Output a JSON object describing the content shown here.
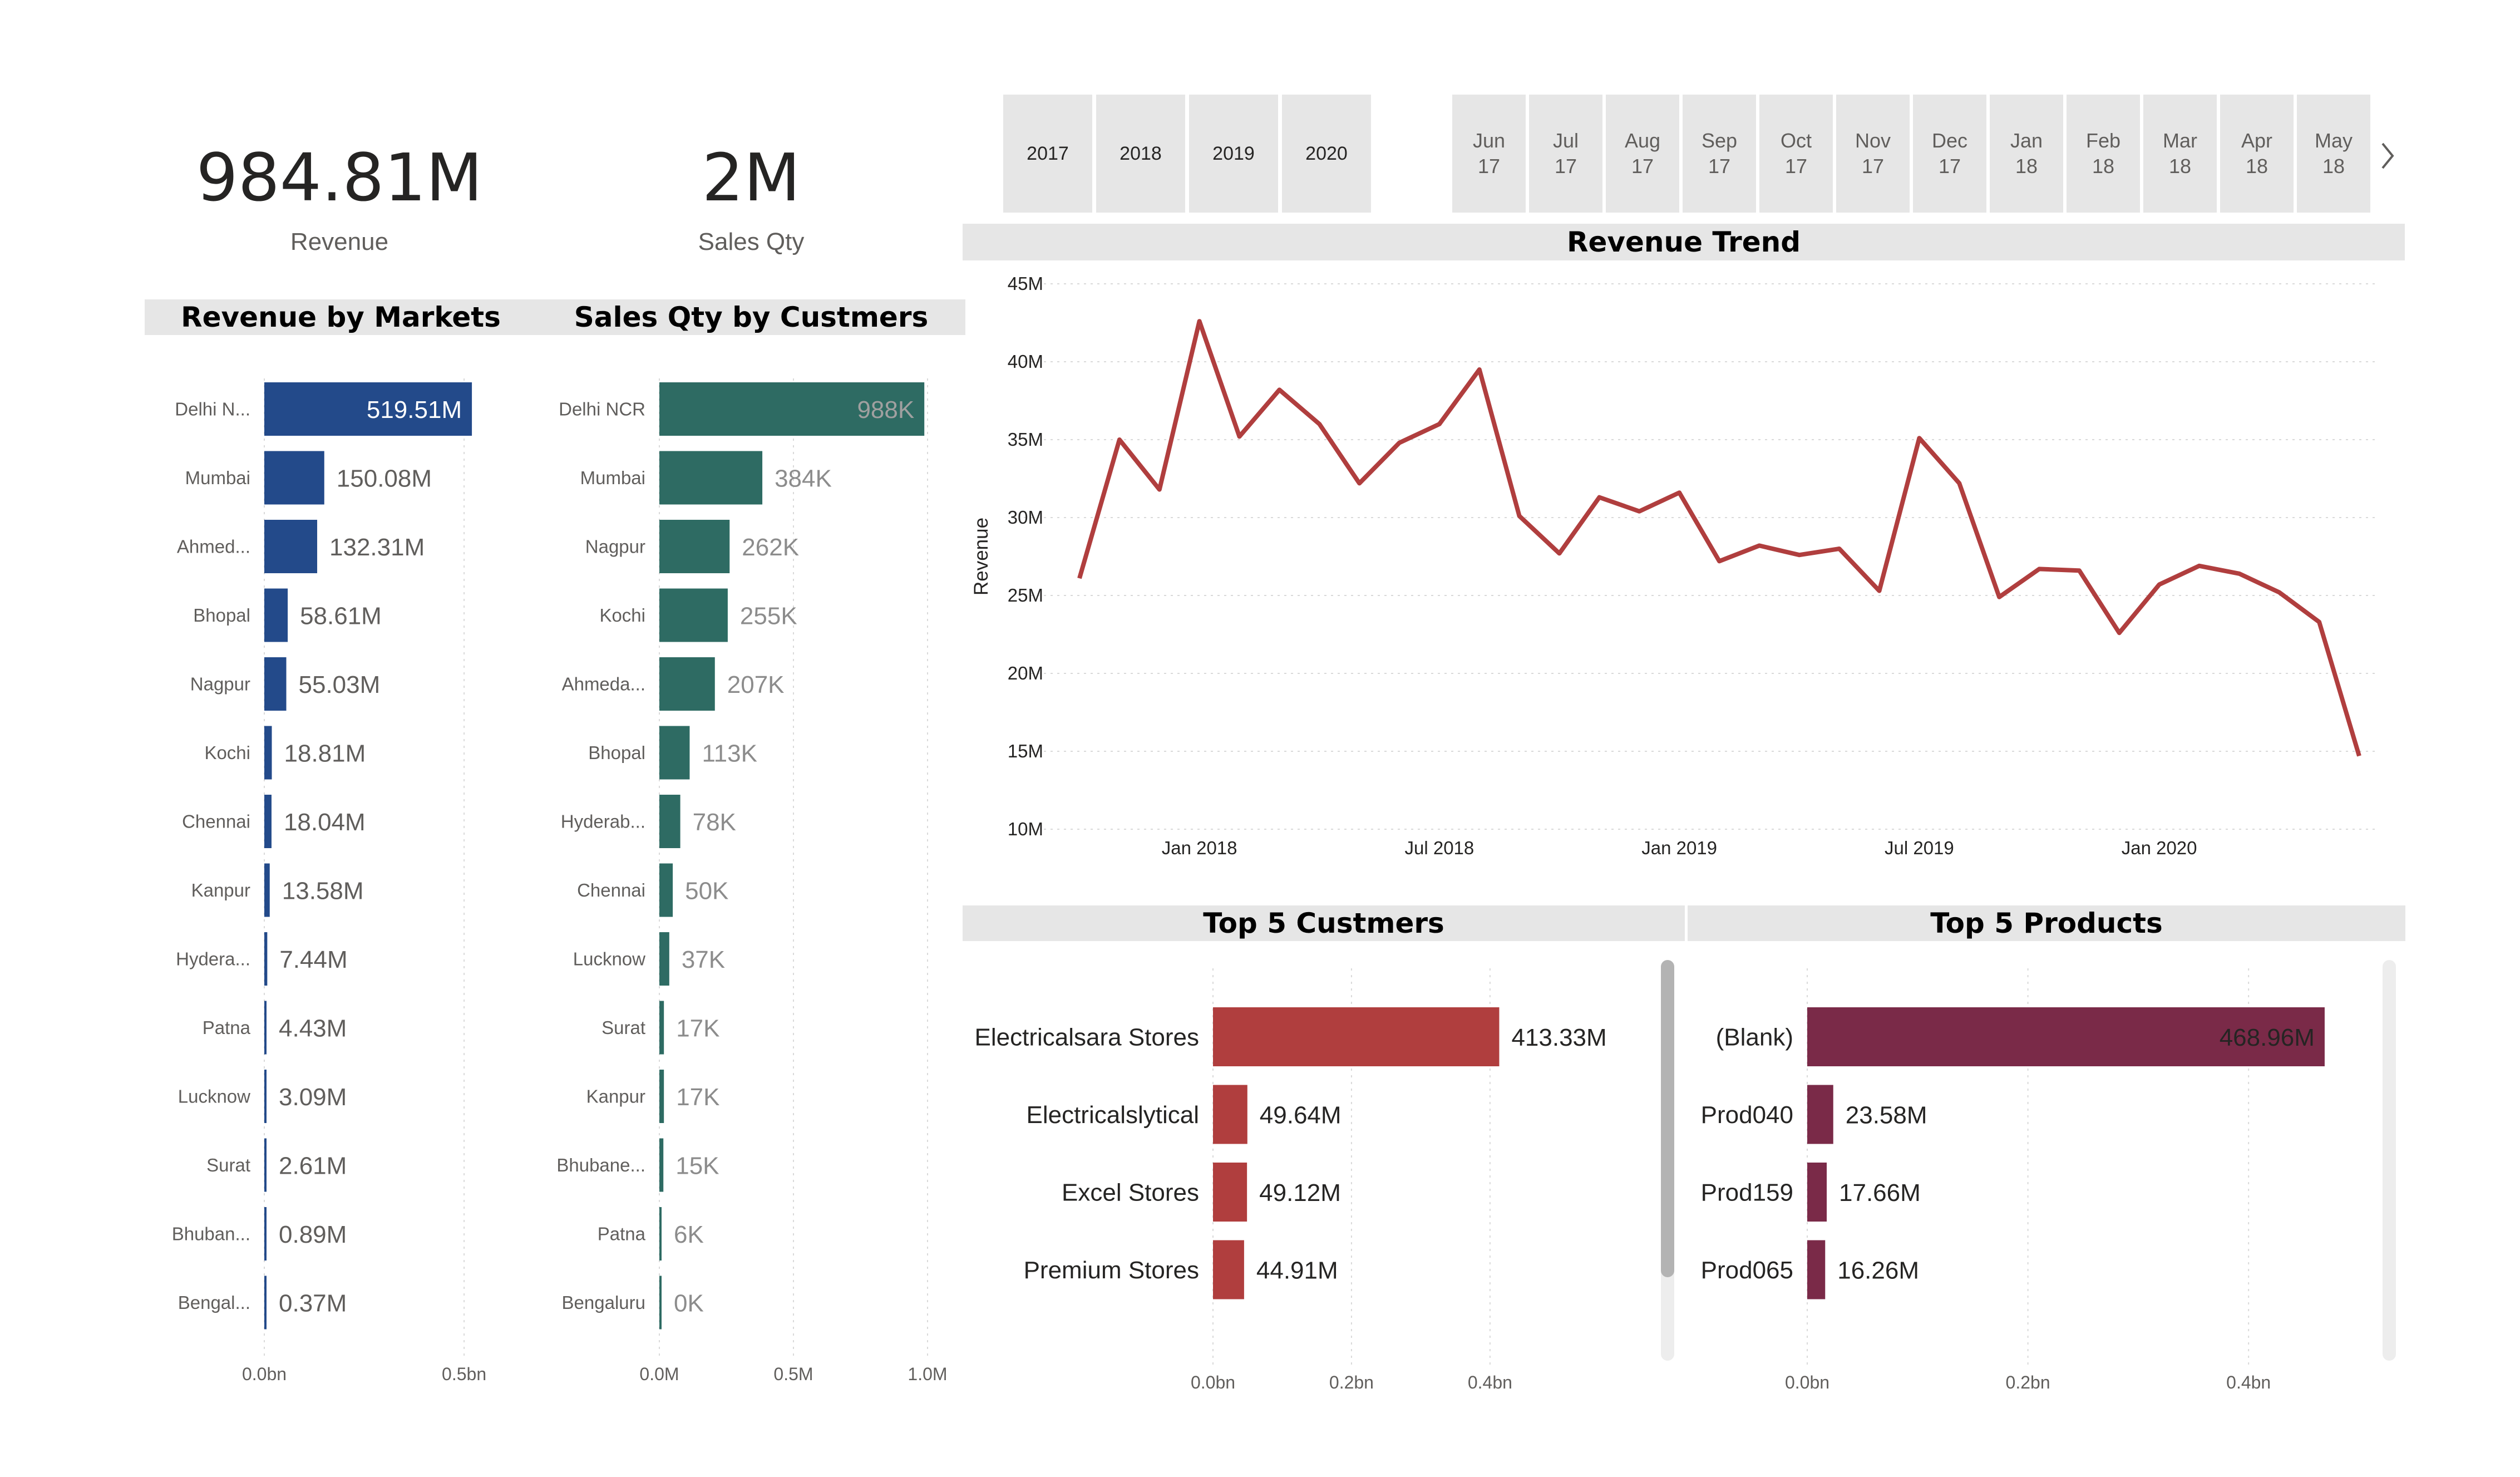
{
  "kpis": {
    "revenue": {
      "value": "984.81M",
      "label": "Revenue"
    },
    "sales_qty": {
      "value": "2M",
      "label": "Sales Qty"
    }
  },
  "year_slicer": [
    "2017",
    "2018",
    "2019",
    "2020"
  ],
  "month_slicer": [
    [
      "Jun",
      "17"
    ],
    [
      "Jul",
      "17"
    ],
    [
      "Aug",
      "17"
    ],
    [
      "Sep",
      "17"
    ],
    [
      "Oct",
      "17"
    ],
    [
      "Nov",
      "17"
    ],
    [
      "Dec",
      "17"
    ],
    [
      "Jan",
      "18"
    ],
    [
      "Feb",
      "18"
    ],
    [
      "Mar",
      "18"
    ],
    [
      "Apr",
      "18"
    ],
    [
      "May",
      "18"
    ]
  ],
  "colors": {
    "markets_bar": "#234A8A",
    "customers_qty_bar": "#2E6B63",
    "trend_line": "#B03E3E",
    "top_customers_bar": "#B03E3E",
    "top_products_bar": "#7A2A48",
    "title_bg": "#E6E6E6"
  },
  "icons": {
    "slicer_next": "chevron-right-icon"
  },
  "chart_data": [
    {
      "id": "revenue_by_markets",
      "type": "bar",
      "orientation": "horizontal",
      "title": "Revenue by Markets",
      "categories": [
        "Delhi N...",
        "Mumbai",
        "Ahmed...",
        "Bhopal",
        "Nagpur",
        "Kochi",
        "Chennai",
        "Kanpur",
        "Hydera...",
        "Patna",
        "Lucknow",
        "Surat",
        "Bhuban...",
        "Bengal..."
      ],
      "values": [
        519.51,
        150.08,
        132.31,
        58.61,
        55.03,
        18.81,
        18.04,
        13.58,
        7.44,
        4.43,
        3.09,
        2.61,
        0.89,
        0.37
      ],
      "data_labels": [
        "519.51M",
        "150.08M",
        "132.31M",
        "58.61M",
        "55.03M",
        "18.81M",
        "18.04M",
        "13.58M",
        "7.44M",
        "4.43M",
        "3.09M",
        "2.61M",
        "0.89M",
        "0.37M"
      ],
      "unit": "M",
      "xlim": [
        0,
        550
      ],
      "xticks": [
        {
          "value": 0,
          "label": "0.0bn"
        },
        {
          "value": 500,
          "label": "0.5bn"
        }
      ],
      "grid": true
    },
    {
      "id": "sales_qty_by_customers",
      "type": "bar",
      "orientation": "horizontal",
      "title": "Sales Qty by Custmers",
      "categories": [
        "Delhi NCR",
        "Mumbai",
        "Nagpur",
        "Kochi",
        "Ahmeda...",
        "Bhopal",
        "Hyderab...",
        "Chennai",
        "Lucknow",
        "Surat",
        "Kanpur",
        "Bhubane...",
        "Patna",
        "Bengaluru"
      ],
      "values": [
        988,
        384,
        262,
        255,
        207,
        113,
        78,
        50,
        37,
        17,
        17,
        15,
        6,
        0
      ],
      "data_labels": [
        "988K",
        "384K",
        "262K",
        "255K",
        "207K",
        "113K",
        "78K",
        "50K",
        "37K",
        "17K",
        "17K",
        "15K",
        "6K",
        "0K"
      ],
      "unit": "K",
      "xlim": [
        0,
        1000
      ],
      "xticks": [
        {
          "value": 0,
          "label": "0.0M"
        },
        {
          "value": 500,
          "label": "0.5M"
        },
        {
          "value": 1000,
          "label": "1.0M"
        }
      ],
      "grid": true
    },
    {
      "id": "revenue_trend",
      "type": "line",
      "title": "Revenue Trend",
      "ylabel": "Revenue",
      "x": [
        "2017-10",
        "2017-11",
        "2017-12",
        "2018-01",
        "2018-02",
        "2018-03",
        "2018-04",
        "2018-05",
        "2018-06",
        "2018-07",
        "2018-08",
        "2018-09",
        "2018-10",
        "2018-11",
        "2018-12",
        "2019-01",
        "2019-02",
        "2019-03",
        "2019-04",
        "2019-05",
        "2019-06",
        "2019-07",
        "2019-08",
        "2019-09",
        "2019-10",
        "2019-11",
        "2019-12",
        "2020-01",
        "2020-02",
        "2020-03",
        "2020-04",
        "2020-05",
        "2020-06"
      ],
      "values": [
        26.1,
        35.0,
        31.8,
        42.6,
        35.2,
        38.2,
        36.0,
        32.2,
        34.8,
        36.0,
        39.5,
        30.1,
        27.7,
        31.3,
        30.4,
        31.6,
        27.2,
        28.2,
        27.6,
        28.0,
        25.3,
        35.1,
        32.2,
        24.9,
        26.7,
        26.6,
        22.6,
        25.7,
        26.9,
        26.4,
        25.2,
        23.3,
        14.7
      ],
      "ylim": [
        10,
        45
      ],
      "yticks": [
        {
          "value": 10,
          "label": "10M"
        },
        {
          "value": 15,
          "label": "15M"
        },
        {
          "value": 20,
          "label": "20M"
        },
        {
          "value": 25,
          "label": "25M"
        },
        {
          "value": 30,
          "label": "30M"
        },
        {
          "value": 35,
          "label": "35M"
        },
        {
          "value": 40,
          "label": "40M"
        },
        {
          "value": 45,
          "label": "45M"
        }
      ],
      "xticks": [
        {
          "value": "2018-01",
          "label": "Jan 2018"
        },
        {
          "value": "2018-07",
          "label": "Jul 2018"
        },
        {
          "value": "2019-01",
          "label": "Jan 2019"
        },
        {
          "value": "2019-07",
          "label": "Jul 2019"
        },
        {
          "value": "2020-01",
          "label": "Jan 2020"
        }
      ],
      "grid": true
    },
    {
      "id": "top5_customers",
      "type": "bar",
      "orientation": "horizontal",
      "title": "Top 5 Custmers",
      "categories": [
        "Electricalsara Stores",
        "Electricalslytical",
        "Excel Stores",
        "Premium Stores"
      ],
      "values": [
        413.33,
        49.64,
        49.12,
        44.91
      ],
      "data_labels": [
        "413.33M",
        "49.64M",
        "49.12M",
        "44.91M"
      ],
      "unit": "M",
      "xlim": [
        0,
        470
      ],
      "xticks": [
        {
          "value": 0,
          "label": "0.0bn"
        },
        {
          "value": 200,
          "label": "0.2bn"
        },
        {
          "value": 400,
          "label": "0.4bn"
        }
      ],
      "grid": true
    },
    {
      "id": "top5_products",
      "type": "bar",
      "orientation": "horizontal",
      "title": "Top 5 Products",
      "categories": [
        "(Blank)",
        "Prod040",
        "Prod159",
        "Prod065"
      ],
      "values": [
        468.96,
        23.58,
        17.66,
        16.26
      ],
      "data_labels": [
        "468.96M",
        "23.58M",
        "17.66M",
        "16.26M"
      ],
      "unit": "M",
      "xlim": [
        0,
        470
      ],
      "xticks": [
        {
          "value": 0,
          "label": "0.0bn"
        },
        {
          "value": 200,
          "label": "0.2bn"
        },
        {
          "value": 400,
          "label": "0.4bn"
        }
      ],
      "grid": true
    }
  ]
}
